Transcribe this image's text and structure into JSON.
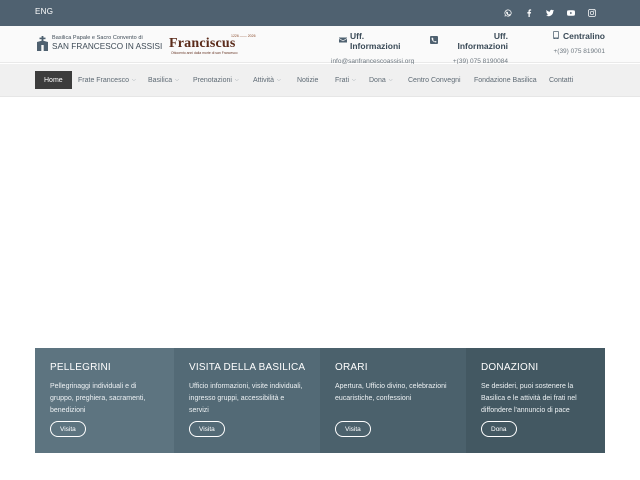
{
  "topbar": {
    "lang": "ENG",
    "socials": [
      "whatsapp-icon",
      "facebook-icon",
      "twitter-icon",
      "youtube-icon",
      "instagram-icon"
    ]
  },
  "header": {
    "logo_line1": "Basilica Papale e Sacro Convento di",
    "logo_line2": "SAN FRANCESCO IN ASSISI",
    "franciscus_word": "Franciscus",
    "franciscus_years": "1226 —— 2026",
    "franciscus_sub": "Ottocento anni dalla morte di san Francesco",
    "contacts": [
      {
        "title": "Uff. Informazioni",
        "value": "info@sanfrancescoassisi.org",
        "icon": "envelope-icon"
      },
      {
        "title": "Uff. Informazioni",
        "value": "+(39) 075 8190084",
        "icon": "phone-icon"
      },
      {
        "title": "Centralino",
        "value": "+(39) 075 819001",
        "icon": "mobile-icon"
      }
    ]
  },
  "nav": {
    "items": [
      {
        "label": "Home",
        "caret": false
      },
      {
        "label": "Frate Francesco",
        "caret": true
      },
      {
        "label": "Basilica",
        "caret": true
      },
      {
        "label": "Prenotazioni",
        "caret": true
      },
      {
        "label": "Attività",
        "caret": true
      },
      {
        "label": "Notizie",
        "caret": false
      },
      {
        "label": "Frati",
        "caret": true
      },
      {
        "label": "Dona",
        "caret": true
      },
      {
        "label": "Centro Convegni",
        "caret": false
      },
      {
        "label": "Fondazione Basilica",
        "caret": false
      },
      {
        "label": "Contatti",
        "caret": false
      }
    ]
  },
  "boxes": [
    {
      "title": "PELLEGRINI",
      "text": "Pellegrinaggi individuali e di gruppo, preghiera, sacramenti, benedizioni",
      "button": "Visita"
    },
    {
      "title": "VISITA DELLA BASILICA",
      "text": "Ufficio informazioni, visite individuali, ingresso gruppi, accessibilità e servizi",
      "button": "Visita"
    },
    {
      "title": "ORARI",
      "text": "Apertura, Ufficio divino, celebrazioni eucaristiche, confessioni",
      "button": "Visita"
    },
    {
      "title": "DONAZIONI",
      "text": "Se desideri, puoi sostenere la Basilica e le attività dei frati nel diffondere l'annuncio di pace",
      "button": "Dona"
    }
  ],
  "colors": {
    "topbar": "#4f6170",
    "nav_active": "#3c3c3c",
    "box1": "#5d7480",
    "box2": "#536a76",
    "box3": "#4b616c",
    "box4": "#435862"
  }
}
